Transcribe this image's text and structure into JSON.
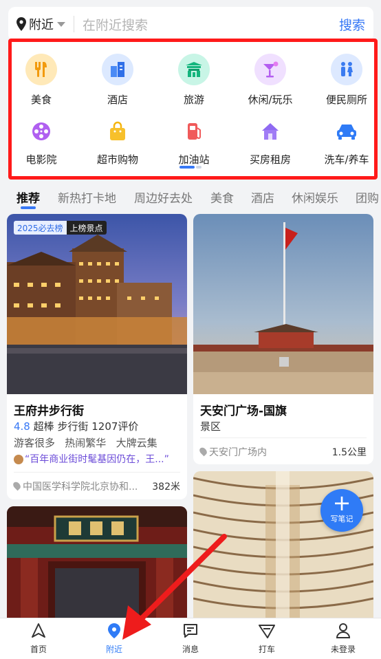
{
  "search": {
    "location": "附近",
    "placeholder": "在附近搜索",
    "button": "搜索"
  },
  "categories": [
    {
      "label": "美食",
      "icon": "fork-knife-icon"
    },
    {
      "label": "酒店",
      "icon": "hotel-building-icon"
    },
    {
      "label": "旅游",
      "icon": "temple-icon"
    },
    {
      "label": "休闲/玩乐",
      "icon": "cocktail-icon"
    },
    {
      "label": "便民厕所",
      "icon": "restroom-icon"
    },
    {
      "label": "电影院",
      "icon": "film-reel-icon"
    },
    {
      "label": "超市购物",
      "icon": "shopping-bag-icon"
    },
    {
      "label": "加油站",
      "icon": "fuel-pump-icon"
    },
    {
      "label": "买房租房",
      "icon": "house-icon"
    },
    {
      "label": "洗车/养车",
      "icon": "car-icon"
    }
  ],
  "tabs": [
    "推荐",
    "新热打卡地",
    "周边好去处",
    "美食",
    "酒店",
    "休闲娱乐",
    "团购"
  ],
  "cards": {
    "c1": {
      "badge1": "2025必去榜",
      "badge2": "上榜景点",
      "title": "王府井步行街",
      "rating": "4.8",
      "rating_word": "超棒",
      "category": "步行街",
      "reviews": "1207评价",
      "tags": "游客很多   热闹繁华   大牌云集",
      "quote": "“百年商业街时髦基因仍在，王...”",
      "address": "中国医学科学院北京协和...",
      "distance": "382米"
    },
    "c2": {
      "title": "天安门广场-国旗",
      "category": "景区",
      "address": "天安门广场内",
      "distance": "1.5公里"
    }
  },
  "fab_label": "写笔记",
  "nav": [
    {
      "label": "首页",
      "icon": "compass-icon"
    },
    {
      "label": "附近",
      "icon": "location-pin-icon"
    },
    {
      "label": "消息",
      "icon": "message-icon"
    },
    {
      "label": "打车",
      "icon": "taxi-icon"
    },
    {
      "label": "未登录",
      "icon": "user-icon"
    }
  ],
  "colors": {
    "accent": "#3778f5",
    "highlight_border": "#ff1a1a",
    "arrow": "#ee1c1c"
  }
}
